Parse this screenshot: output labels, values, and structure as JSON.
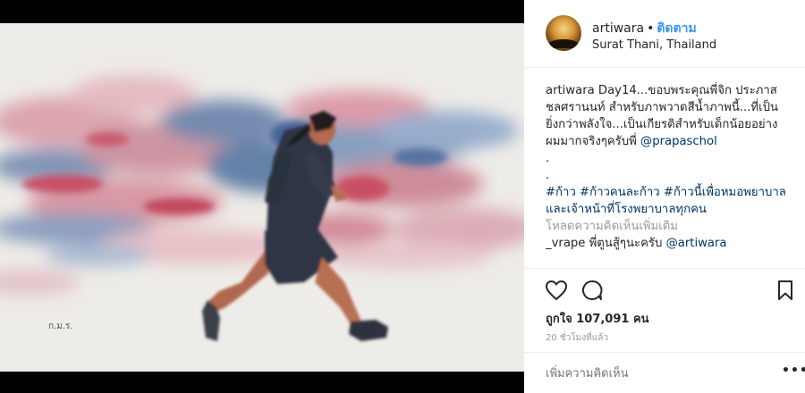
{
  "post": {
    "username": "artiwara",
    "separator": "•",
    "follow_label": "ติดตาม",
    "location": "Surat Thani, Thailand",
    "caption": {
      "author": "artiwara",
      "text": "Day14...ขอบพระคุณพี่จิก ประภาส ชลศรานนท์ สำหรับภาพวาดสีน้ำภาพนี้...ที่เป็นยิ่งกว่าพลังใจ...เป็นเกียรติสำหรับเด็กน้อยอย่างผมมากจริงๆครับพี่",
      "mention": "@prapaschol",
      "dot1": ".",
      "dot2": ".",
      "hashtags": "#ก้าว #ก้าวคนละก้าว #ก้าวนี้เพื่อหมอพยาบาลและเจ้าหน้าที่โรงพยาบาลทุกคน"
    },
    "load_more_label": "โหลดความคิดเห็นเพิ่มเติม",
    "reply": {
      "author": "_vrape",
      "text": "พี่ตูนสู้ๆนะครับ",
      "mention": "@artiwara"
    },
    "likes_label": "ถูกใจ 107,091 คน",
    "time_label": "20 ชั่วโมงที่แล้ว",
    "comment_placeholder": "เพิ่มความคิดเห็น",
    "more_label": "•••",
    "painting_signature": "ก.ม.ร."
  },
  "icons": {
    "like": "heart-icon",
    "comment": "speech-bubble-icon",
    "save": "bookmark-icon",
    "more": "ellipsis-icon"
  },
  "colors": {
    "follow": "#3897f0",
    "link": "#003569",
    "muted": "#999999"
  }
}
